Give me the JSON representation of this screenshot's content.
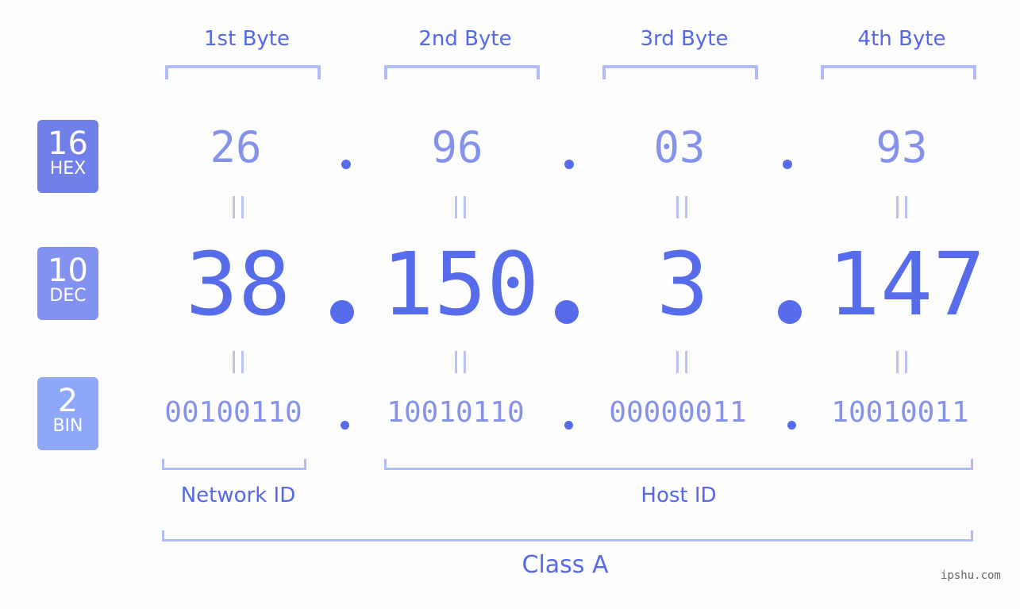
{
  "headers": [
    "1st Byte",
    "2nd Byte",
    "3rd Byte",
    "4th Byte"
  ],
  "badges": [
    {
      "base": "16",
      "name": "HEX",
      "color": "#717fe9"
    },
    {
      "base": "10",
      "name": "DEC",
      "color": "#8391f0"
    },
    {
      "base": "2",
      "name": "BIN",
      "color": "#8fa7f8"
    }
  ],
  "hex": [
    "26",
    "96",
    "03",
    "93"
  ],
  "dec": [
    "38",
    "150",
    "3",
    "147"
  ],
  "bin": [
    "00100110",
    "10010110",
    "00000011",
    "10010011"
  ],
  "labels": {
    "network": "Network ID",
    "host": "Host ID",
    "class": "Class A"
  },
  "watermark": "ipshu.com",
  "colors": {
    "accent": "#566ceb",
    "light": "#8592ec",
    "bracket": "#b1bcf6"
  }
}
